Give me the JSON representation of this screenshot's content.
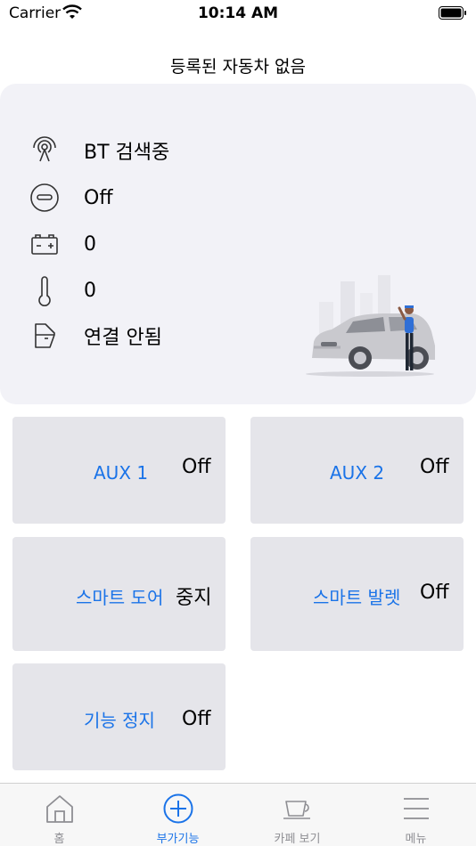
{
  "status_bar": {
    "carrier": "Carrier",
    "time": "10:14 AM"
  },
  "header": {
    "title": "등록된 자동차 없음"
  },
  "status": {
    "bt": "BT 검색중",
    "engine": "Off",
    "battery": "0",
    "temperature": "0",
    "door": "연결 안됨"
  },
  "features": [
    {
      "label": "AUX 1",
      "value": "Off"
    },
    {
      "label": "AUX 2",
      "value": "Off"
    },
    {
      "label": "스마트 도어",
      "value": "중지"
    },
    {
      "label": "스마트 발렛",
      "value": "Off"
    },
    {
      "label": "기능 정지",
      "value": "Off"
    }
  ],
  "tabs": [
    {
      "label": "홈",
      "icon": "home-icon"
    },
    {
      "label": "부가기능",
      "icon": "plus-circle-icon"
    },
    {
      "label": "카페 보기",
      "icon": "coffee-cup-icon"
    },
    {
      "label": "메뉴",
      "icon": "hamburger-menu-icon"
    }
  ],
  "colors": {
    "accent": "#1a73e8",
    "card": "#f2f2f7",
    "tile": "#e5e5ea",
    "tab_inactive": "#8e8e93"
  }
}
